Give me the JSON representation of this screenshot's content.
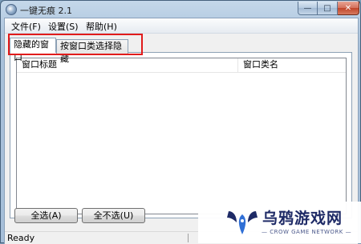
{
  "window": {
    "title": "一键无痕 2.1",
    "min_glyph": "—",
    "max_glyph": "□",
    "close_glyph": "✕"
  },
  "menu": {
    "items": [
      "文件(F)",
      "设置(S)",
      "帮助(H)"
    ]
  },
  "tabs": [
    {
      "label": "隐藏的窗口",
      "active": true
    },
    {
      "label": "按窗口类选择隐藏",
      "active": false
    }
  ],
  "list": {
    "columns": [
      "窗口标题",
      "窗口类名"
    ],
    "rows": []
  },
  "buttons": {
    "select_all": "全选(A)",
    "select_none": "全不选(U)"
  },
  "status": {
    "text": "Ready"
  },
  "watermark": {
    "name": "乌鸦游戏网",
    "sub": "— CROW GAME NETWORK —"
  },
  "colors": {
    "highlight": "#e11b1b",
    "watermark_blue": "#1e2a66"
  }
}
